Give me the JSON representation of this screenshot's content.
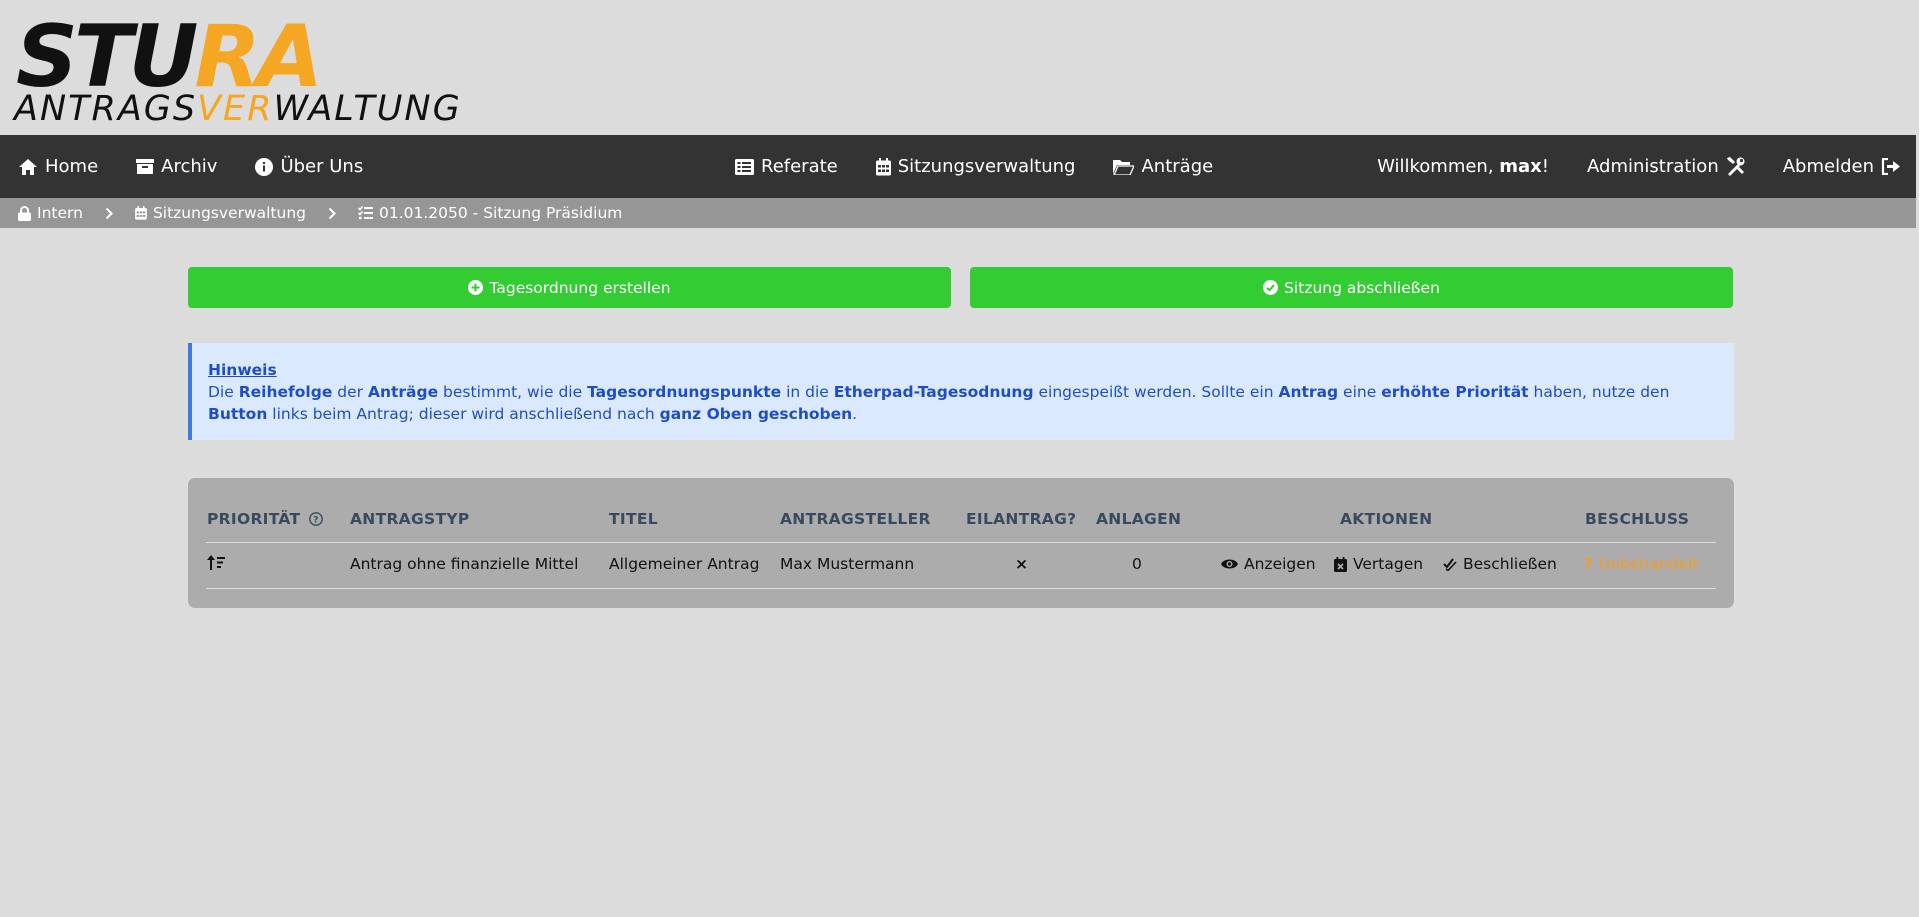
{
  "logo": {
    "word_main": "STU",
    "word_accent": "RA",
    "sub_a": "ANTRAGS",
    "sub_b": "VER",
    "sub_c": "WALTUNG"
  },
  "nav": {
    "home": "Home",
    "archive": "Archiv",
    "about": "Über Uns",
    "departments": "Referate",
    "session_mgmt": "Sitzungsverwaltung",
    "motions": "Anträge",
    "welcome_prefix": "Willkommen, ",
    "welcome_user": "max",
    "welcome_suffix": "!",
    "admin": "Administration",
    "logout": "Abmelden"
  },
  "breadcrumb": {
    "intern": "Intern",
    "session_mgmt": "Sitzungsverwaltung",
    "current": "01.01.2050 - Sitzung Präsidium"
  },
  "buttons": {
    "create_agenda": "Tagesordnung erstellen",
    "close_session": "Sitzung abschließen"
  },
  "notice": {
    "title": "Hinweis",
    "p1": "Die ",
    "b1": "Reihefolge",
    "p2": " der ",
    "b2": "Anträge",
    "p3": " bestimmt, wie die ",
    "b3": "Tagesordnungspunkte",
    "p4": " in die ",
    "b4": "Etherpad-Tagesodnung",
    "p5": " eingespeißt werden. Sollte ein ",
    "b5": "Antrag",
    "p6": " eine ",
    "b6": "erhöhte Priorität",
    "p7": " haben, nutze den ",
    "b7": "Button",
    "p8": " links beim Antrag; dieser wird anschließend nach ",
    "b8": "ganz Oben geschoben",
    "p9": "."
  },
  "table": {
    "headers": {
      "priority": "PRIORITÄT",
      "type": "ANTRAGSTYP",
      "title": "TITEL",
      "applicant": "ANTRAGSTELLER",
      "urgent": "EILANTRAG?",
      "attachments": "ANLAGEN",
      "actions": "AKTIONEN",
      "decision": "BESCHLUSS"
    },
    "rows": [
      {
        "type": "Antrag ohne finanzielle Mittel",
        "title": "Allgemeiner Antrag",
        "applicant": "Max Mustermann",
        "urgent": "×",
        "attachments": "0",
        "action_view": "Anzeigen",
        "action_postpone": "Vertagen",
        "action_decide": "Beschließen",
        "decision": "Unbehandelt"
      }
    ]
  },
  "colors": {
    "navbar": "#333333",
    "breadcrumb": "#969696",
    "green": "#33cc33",
    "notice_bg": "#dbe9ff",
    "notice_text": "#1f4fbf",
    "accent": "#f5a623"
  }
}
